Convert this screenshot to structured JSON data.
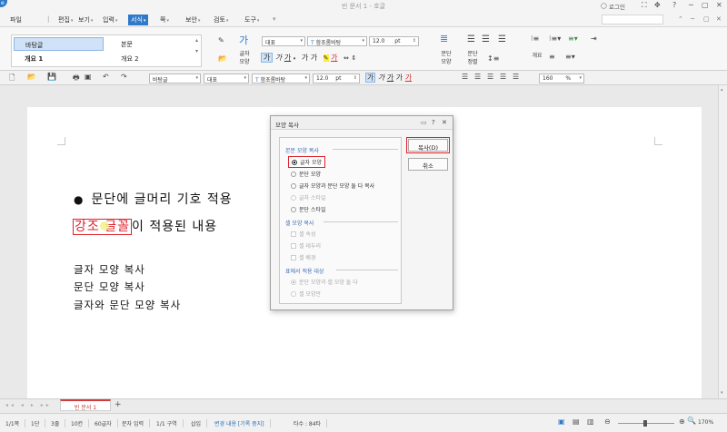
{
  "titlebar": {
    "title": "빈 문서 1 - 호글",
    "login_label": "로그인",
    "controls": [
      "?",
      "─",
      "▢",
      "✕"
    ]
  },
  "menubar": {
    "file": "파일",
    "items": [
      "편집",
      "보기",
      "입력",
      "서식",
      "쪽",
      "보안",
      "검토",
      "도구"
    ],
    "selected": "서식"
  },
  "ribbon": {
    "styles": [
      "바탕글",
      "본문",
      "개요 1",
      "개요 2"
    ],
    "char_shape_label": "글자\n모양",
    "font_lang": "대표",
    "font_name": "함초롬바탕",
    "font_size": "12.0",
    "unit": "pt",
    "para_shape_label": "문단\n모양",
    "para_align_label": "문단\n정렬",
    "outline_label": "개요"
  },
  "toolbar2": {
    "style": "바탕글",
    "font_lang": "대표",
    "font_name": "함초롬바탕",
    "font_size": "12.0",
    "unit": "pt",
    "zoom": "160",
    "zoom_unit": "%"
  },
  "document": {
    "bullet_line": "문단에 글머리 기호 적용",
    "bullet": "●",
    "highlight_text": "강조 글꼴",
    "after_highlight": "이 적용된 내용",
    "line1": "글자 모양 복사",
    "line2": "문단 모양 복사",
    "line3": "글자와 문단 모양 복사"
  },
  "dialog": {
    "title": "모양 복사",
    "title_icons": [
      "?",
      "✕"
    ],
    "section1": "본문 모양 복사",
    "options": [
      "글자 모양",
      "문단 모양",
      "글자 모양과 문단 모양 둘 다 복사",
      "글자 스타일",
      "문단 스타일"
    ],
    "section2": "셀 모양 복사",
    "cell_options": [
      "셀 속성",
      "셀 테두리",
      "셀 배경"
    ],
    "section3": "표에서 적용 대상",
    "table_options": [
      "문단 모양과 셀 모양 둘 다",
      "셀 모양만"
    ],
    "copy_button": "복사(D)",
    "cancel_button": "취소"
  },
  "tabbar": {
    "doc_tab": "빈 문서 1",
    "add": "+"
  },
  "statusbar": {
    "items": [
      "1/1쪽",
      "1단",
      "3줄",
      "10칸",
      "60글자",
      "문자 입력",
      "1/1 구역",
      "삽입",
      "변경 내용 [기록 중지]",
      "타수 : 84타"
    ],
    "zoom": "170%"
  },
  "colors": {
    "accent": "#2f79c9",
    "highlight_red": "#e0202b",
    "cursor_yellow": "#f3f08a"
  }
}
